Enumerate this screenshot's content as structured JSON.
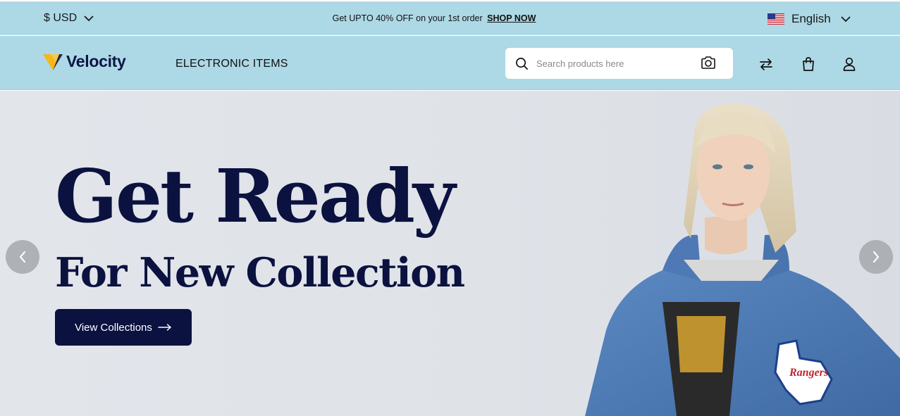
{
  "topbar": {
    "currency": "$ USD",
    "promo_text": "Get UPTO 40% OFF on your 1st order",
    "promo_link": "SHOP NOW",
    "language": "English",
    "flag": "us-flag-icon"
  },
  "header": {
    "brand": "Velocity",
    "nav_link": "ELECTRONIC ITEMS",
    "search_placeholder": "Search products here",
    "icons": [
      "search-icon",
      "camera-icon",
      "compare-icon",
      "bag-icon",
      "user-icon"
    ]
  },
  "hero": {
    "title": "Get Ready",
    "subtitle": "For New Collection",
    "cta_label": "View Collections",
    "prev_icon": "chevron-left-icon",
    "next_icon": "chevron-right-icon",
    "model_text": "Rangers"
  },
  "colors": {
    "header_bg": "#add8e6",
    "brand_navy": "#0b1240",
    "logo_accent": "#f5b81c"
  }
}
